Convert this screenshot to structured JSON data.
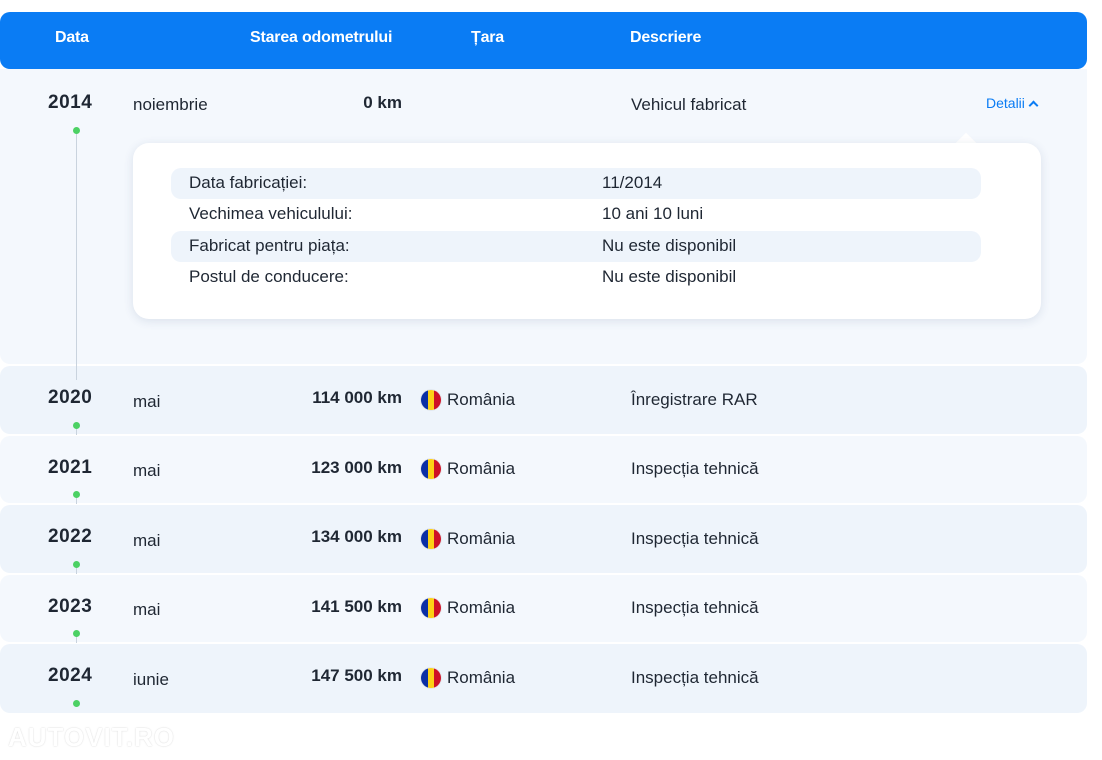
{
  "header": {
    "date": "Data",
    "odometer": "Starea odometrului",
    "country": "Țara",
    "description": "Descriere"
  },
  "rows": [
    {
      "year": "2014",
      "month": "noiembrie",
      "odometer": "0 km",
      "country": "",
      "description": "Vehicul fabricat",
      "details_label": "Detalii"
    },
    {
      "year": "2020",
      "month": "mai",
      "odometer": "114 000 km",
      "country": "România",
      "description": "Înregistrare RAR"
    },
    {
      "year": "2021",
      "month": "mai",
      "odometer": "123 000 km",
      "country": "România",
      "description": "Inspecția tehnică"
    },
    {
      "year": "2022",
      "month": "mai",
      "odometer": "134 000 km",
      "country": "România",
      "description": "Inspecția tehnică"
    },
    {
      "year": "2023",
      "month": "mai",
      "odometer": "141 500 km",
      "country": "România",
      "description": "Inspecția tehnică"
    },
    {
      "year": "2024",
      "month": "iunie",
      "odometer": "147 500 km",
      "country": "România",
      "description": "Inspecția tehnică"
    }
  ],
  "details": [
    {
      "label": "Data fabricației:",
      "value": "11/2014"
    },
    {
      "label": "Vechimea vehiculului:",
      "value": "10 ani 10 luni"
    },
    {
      "label": "Fabricat pentru piața:",
      "value": "Nu este disponibil"
    },
    {
      "label": "Postul de conducere:",
      "value": "Nu este disponibil"
    }
  ],
  "flag_colors": [
    "#0b2fa5",
    "#fcd116",
    "#ce1126"
  ],
  "accent_color": "#0a7cf4",
  "timeline_dot_color": "#4cd164",
  "watermark": "AUTOVIT.RO"
}
